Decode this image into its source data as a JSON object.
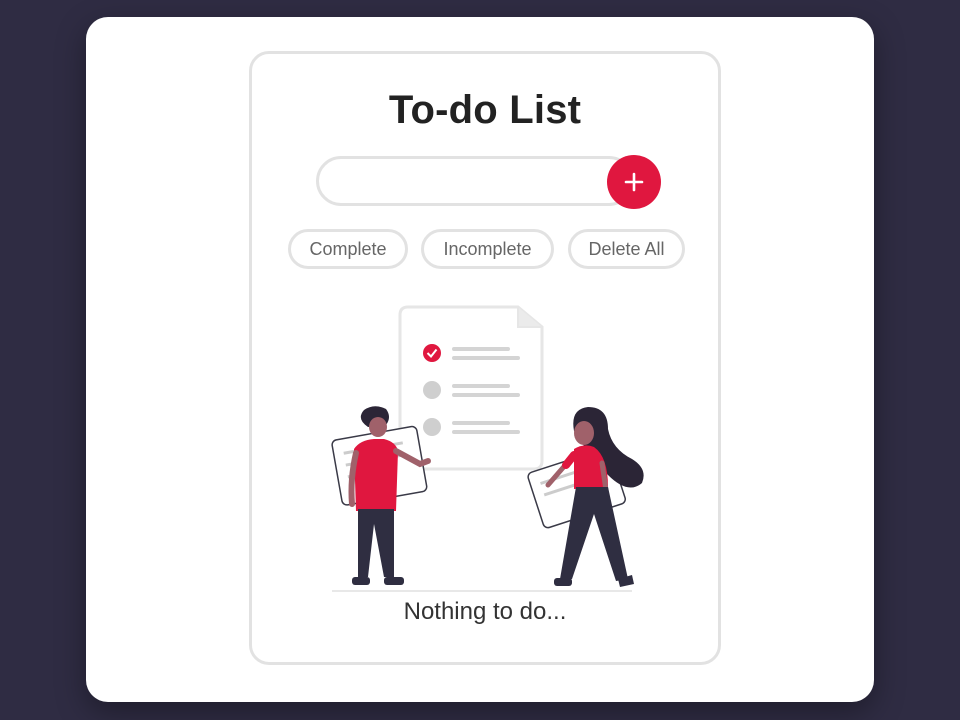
{
  "app": {
    "title": "To-do List"
  },
  "task_input": {
    "value": "",
    "placeholder": ""
  },
  "add_button": {
    "icon": "plus-icon"
  },
  "filters": {
    "complete": "Complete",
    "incomplete": "Incomplete",
    "delete_all": "Delete All"
  },
  "empty_state": {
    "illustration": "people-with-checklist-illustration",
    "message": "Nothing to do..."
  },
  "colors": {
    "accent": "#e0173f",
    "background": "#2f2c43",
    "border": "#e2e2e2"
  }
}
